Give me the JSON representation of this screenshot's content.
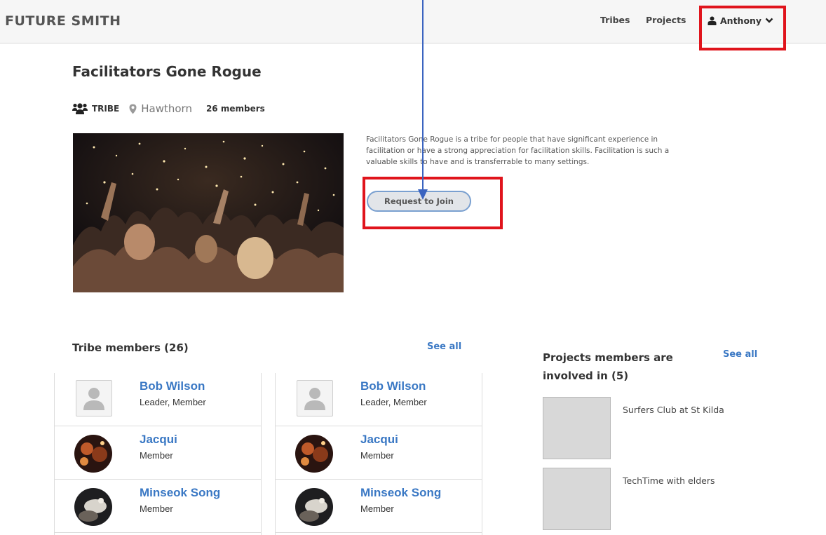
{
  "nav": {
    "brand": "FUTURE SMITH",
    "links": [
      "Tribes",
      "Projects"
    ],
    "user": "Anthony"
  },
  "tribe": {
    "title": "Facilitators Gone Rogue",
    "type": "TRIBE",
    "location": "Hawthorn",
    "members_count": "26 members",
    "description": "Facilitators Gone Rogue is a tribe for people that have significant experience in facilitation or have a strong appreciation for facilitation skills. Facilitation is such a valuable skills to have and is transferrable to many settings.",
    "join_label": "Request to Join"
  },
  "members": {
    "heading": "Tribe members (26)",
    "see_all": "See all",
    "left": [
      {
        "name": "Bob Wilson",
        "role": "Leader, Member"
      },
      {
        "name": "Jacqui",
        "role": "Member"
      },
      {
        "name": "Minseok Song",
        "role": "Member"
      }
    ],
    "right": [
      {
        "name": "Bob Wilson",
        "role": "Leader, Member"
      },
      {
        "name": "Jacqui",
        "role": "Member"
      },
      {
        "name": "Minseok Song",
        "role": "Member"
      }
    ]
  },
  "projects": {
    "heading": "Projects members are involved in (5)",
    "see_all": "See all",
    "items": [
      "Surfers Club at St Kilda",
      "TechTime with elders"
    ]
  },
  "colors": {
    "link_blue": "#3a78c4",
    "annotation_red": "#e0141c",
    "arrow_blue": "#3b64c0"
  }
}
